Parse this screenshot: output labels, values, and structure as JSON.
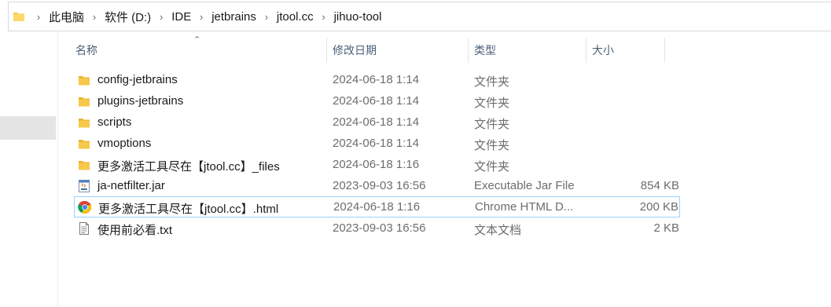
{
  "address_bar": {
    "breadcrumbs": [
      "此电脑",
      "软件 (D:)",
      "IDE",
      "jetbrains",
      "jtool.cc",
      "jihuo-tool"
    ]
  },
  "columns": {
    "name": "名称",
    "date": "修改日期",
    "type": "类型",
    "size": "大小"
  },
  "files": [
    {
      "name": "config-jetbrains",
      "date": "2024-06-18 1:14",
      "type": "文件夹",
      "size": "",
      "icon": "folder-icon"
    },
    {
      "name": "plugins-jetbrains",
      "date": "2024-06-18 1:14",
      "type": "文件夹",
      "size": "",
      "icon": "folder-icon"
    },
    {
      "name": "scripts",
      "date": "2024-06-18 1:14",
      "type": "文件夹",
      "size": "",
      "icon": "folder-icon"
    },
    {
      "name": "vmoptions",
      "date": "2024-06-18 1:14",
      "type": "文件夹",
      "size": "",
      "icon": "folder-icon"
    },
    {
      "name": "更多激活工具尽在【jtool.cc】_files",
      "date": "2024-06-18 1:16",
      "type": "文件夹",
      "size": "",
      "icon": "folder-icon"
    },
    {
      "name": "ja-netfilter.jar",
      "date": "2023-09-03 16:56",
      "type": "Executable Jar File",
      "size": "854 KB",
      "icon": "java-jar-icon"
    },
    {
      "name": "更多激活工具尽在【jtool.cc】.html",
      "date": "2024-06-18 1:16",
      "type": "Chrome HTML D...",
      "size": "200 KB",
      "icon": "chrome-icon"
    },
    {
      "name": "使用前必看.txt",
      "date": "2023-09-03 16:56",
      "type": "文本文档",
      "size": "2 KB",
      "icon": "text-document-icon"
    }
  ],
  "selected_index": 6,
  "colors": {
    "folder": "#f8c84a",
    "header_text": "#4c607a",
    "selection_border": "#99d1ff",
    "nav_selected": "#e5e5e5"
  }
}
